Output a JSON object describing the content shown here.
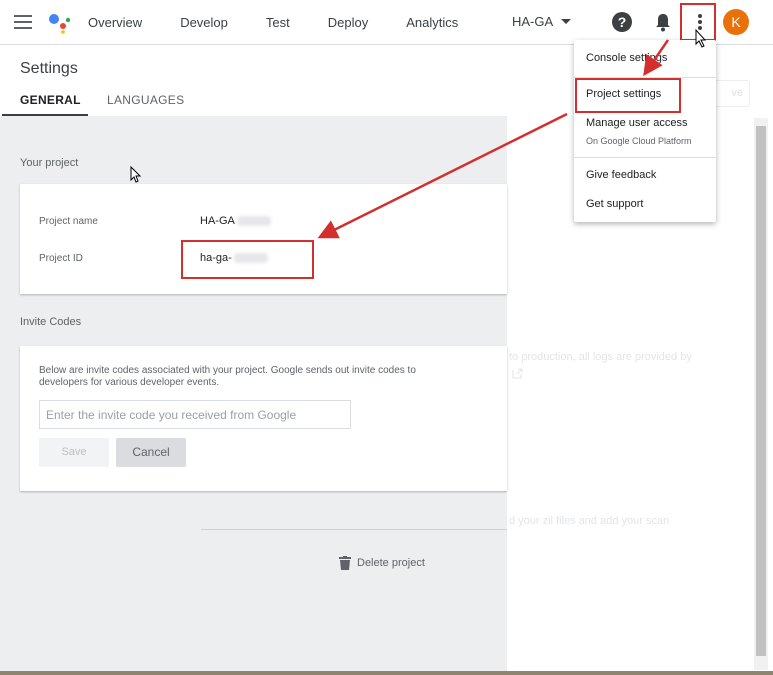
{
  "topbar": {
    "nav": [
      "Overview",
      "Develop",
      "Test",
      "Deploy",
      "Analytics"
    ],
    "project": "HA-GA",
    "help": "?",
    "avatar": "K"
  },
  "settings": {
    "title": "Settings",
    "tabs": [
      "GENERAL",
      "LANGUAGES"
    ],
    "your_project": {
      "heading": "Your project",
      "name_label": "Project name",
      "name_value": "HA-GA",
      "id_label": "Project ID",
      "id_value": "ha-ga-"
    },
    "invite": {
      "heading": "Invite Codes",
      "description": "Below are invite codes associated with your project. Google sends out invite codes to developers for various developer events.",
      "placeholder": "Enter the invite code you received from Google",
      "save": "Save",
      "cancel": "Cancel"
    },
    "delete": "Delete project"
  },
  "menu": {
    "console_settings": "Console settings",
    "project_settings": "Project settings",
    "manage_access": "Manage user access",
    "manage_access_sub": "On Google Cloud Platform",
    "feedback": "Give feedback",
    "support": "Get support"
  },
  "background": {
    "text1": "to production, all logs are provided by",
    "text2": "d your zil files and add your scan",
    "button": "ve"
  },
  "colors": {
    "accent": "#e8710a",
    "annotation": "#d32f2f"
  }
}
